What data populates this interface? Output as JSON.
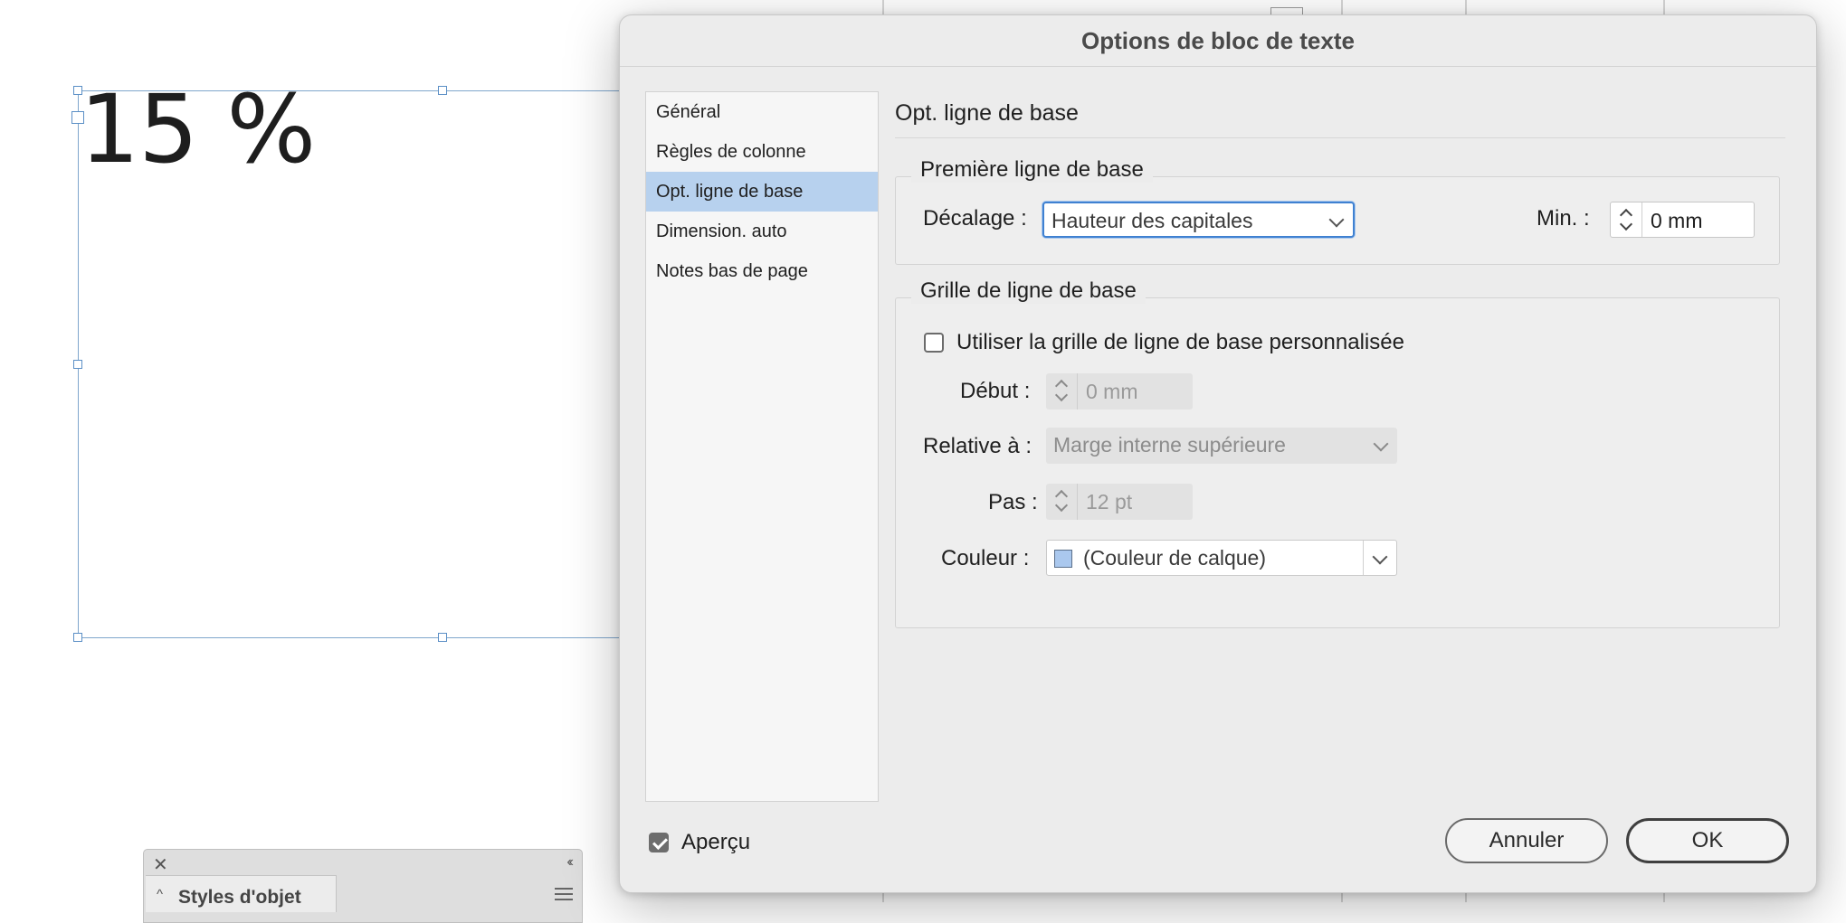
{
  "canvas": {
    "frame_text": "15 %"
  },
  "styles_panel": {
    "tab_label": "Styles d'objet",
    "close_glyph": "✕",
    "collapse_glyph": "‹‹",
    "chevron_glyph": "^"
  },
  "dialog": {
    "title": "Options de bloc de texte",
    "sidebar": [
      {
        "label": "Général",
        "selected": false
      },
      {
        "label": "Règles de colonne",
        "selected": false
      },
      {
        "label": "Opt. ligne de base",
        "selected": true
      },
      {
        "label": "Dimension. auto",
        "selected": false
      },
      {
        "label": "Notes bas de page",
        "selected": false
      }
    ],
    "section_title": "Opt. ligne de base",
    "first_baseline": {
      "legend": "Première ligne de base",
      "offset_label": "Décalage :",
      "offset_value": "Hauteur des capitales",
      "min_label": "Min. :",
      "min_value": "0 mm"
    },
    "baseline_grid": {
      "legend": "Grille de ligne de base",
      "custom_checkbox_label": "Utiliser la grille de ligne de base personnalisée",
      "custom_checked": false,
      "start_label": "Début :",
      "start_value": "0 mm",
      "relative_label": "Relative à :",
      "relative_value": "Marge interne supérieure",
      "increment_label": "Pas :",
      "increment_value": "12 pt",
      "color_label": "Couleur :",
      "color_value": "(Couleur de calque)",
      "color_swatch": "#aac8ee"
    },
    "preview_label": "Aperçu",
    "preview_checked": true,
    "cancel_label": "Annuler",
    "ok_label": "OK"
  },
  "colors": {
    "selection_blue": "#b7d1ee",
    "focus_ring": "#3f81d1",
    "frame_border": "#7fa6cc"
  }
}
